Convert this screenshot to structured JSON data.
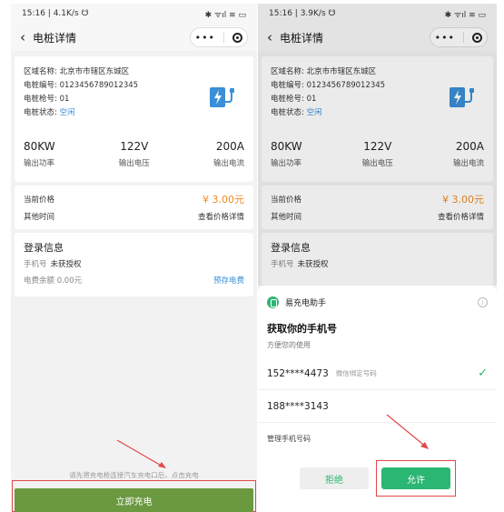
{
  "left": {
    "status": {
      "left": "15:16 | 4.1K/s ☋",
      "right": "✱ ᯤıl ≋ ▭"
    },
    "nav": {
      "back_icon": "‹",
      "title": "电桩详情",
      "more": "•••"
    },
    "info": {
      "area": "区域名称: 北京市市辖区东城区",
      "pile_no": "电桩编号: 0123456789012345",
      "gun_no": "电桩枪号: 01",
      "status_label": "电桩状态: ",
      "status_value": "空闲"
    },
    "specs": [
      {
        "value": "80KW",
        "label": "输出功率"
      },
      {
        "value": "122V",
        "label": "输出电压"
      },
      {
        "value": "200A",
        "label": "输出电流"
      }
    ],
    "price": {
      "label": "当前价格",
      "value": "¥ 3.00元",
      "other_label": "其他时间",
      "details_link": "查看价格详情"
    },
    "login": {
      "title": "登录信息",
      "phone_label": "手机号",
      "phone_value": "未获授权",
      "balance": "电费余额 0.00元",
      "prepay_link": "预存电费"
    },
    "hint": "请先将充电枪连接汽车充电口后，点击充电",
    "charge_button": "立即充电"
  },
  "right": {
    "status": {
      "left": "15:16 | 3.9K/s ☋",
      "right": "✱ ᯤıl ≋ ▭"
    },
    "nav": {
      "back_icon": "‹",
      "title": "电桩详情",
      "more": "•••"
    },
    "info": {
      "area": "区域名称: 北京市市辖区东城区",
      "pile_no": "电桩编号: 0123456789012345",
      "gun_no": "电桩枪号: 01",
      "status_label": "电桩状态: ",
      "status_value": "空闲"
    },
    "specs": [
      {
        "value": "80KW",
        "label": "输出功率"
      },
      {
        "value": "122V",
        "label": "输出电压"
      },
      {
        "value": "200A",
        "label": "输出电流"
      }
    ],
    "price": {
      "label": "当前价格",
      "value": "¥ 3.00元",
      "other_label": "其他时间",
      "details_link": "查看价格详情"
    },
    "login": {
      "title": "登录信息",
      "phone_label": "手机号",
      "phone_value": "未获授权"
    },
    "sheet": {
      "app_name": "易充电助手",
      "info_glyph": "i",
      "title": "获取你的手机号",
      "subtitle": "方便您的使用",
      "options": [
        {
          "number": "152****4473",
          "tag": "微信绑定号码",
          "selected_icon": "✓"
        },
        {
          "number": "188****3143",
          "tag": "",
          "selected_icon": ""
        }
      ],
      "manage": "管理手机号码",
      "refuse": "拒绝",
      "allow": "允许"
    }
  },
  "colors": {
    "accent_green": "#2bb673",
    "charge_button": "#6a9940",
    "price_orange": "#f08a24",
    "link_blue": "#3a8fd6",
    "annotation_red": "#e24a4a"
  },
  "icons": [
    "back-icon",
    "more-icon",
    "target-icon",
    "ev-charger-icon",
    "info-icon",
    "check-icon",
    "annotation-arrow"
  ]
}
